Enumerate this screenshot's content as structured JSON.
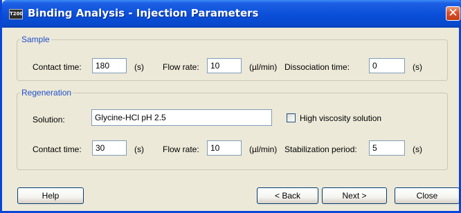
{
  "window": {
    "title": "Binding Analysis - Injection Parameters",
    "app_icon_text": "T200",
    "close_glyph": "✕"
  },
  "sample": {
    "legend": "Sample",
    "contact_time_label": "Contact time:",
    "contact_time_value": "180",
    "contact_time_unit": "(s)",
    "flow_rate_label": "Flow rate:",
    "flow_rate_value": "10",
    "flow_rate_unit": "(µl/min)",
    "dissociation_label": "Dissociation time:",
    "dissociation_value": "0",
    "dissociation_unit": "(s)"
  },
  "regeneration": {
    "legend": "Regeneration",
    "solution_label": "Solution:",
    "solution_value": "Glycine-HCl pH 2.5",
    "high_viscosity_label": "High viscosity solution",
    "high_viscosity_checked": false,
    "contact_time_label": "Contact time:",
    "contact_time_value": "30",
    "contact_time_unit": "(s)",
    "flow_rate_label": "Flow rate:",
    "flow_rate_value": "10",
    "flow_rate_unit": "(µl/min)",
    "stabilization_label": "Stabilization period:",
    "stabilization_value": "5",
    "stabilization_unit": "(s)"
  },
  "buttons": {
    "help": "Help",
    "back": "< Back",
    "next": "Next >",
    "close": "Close"
  }
}
